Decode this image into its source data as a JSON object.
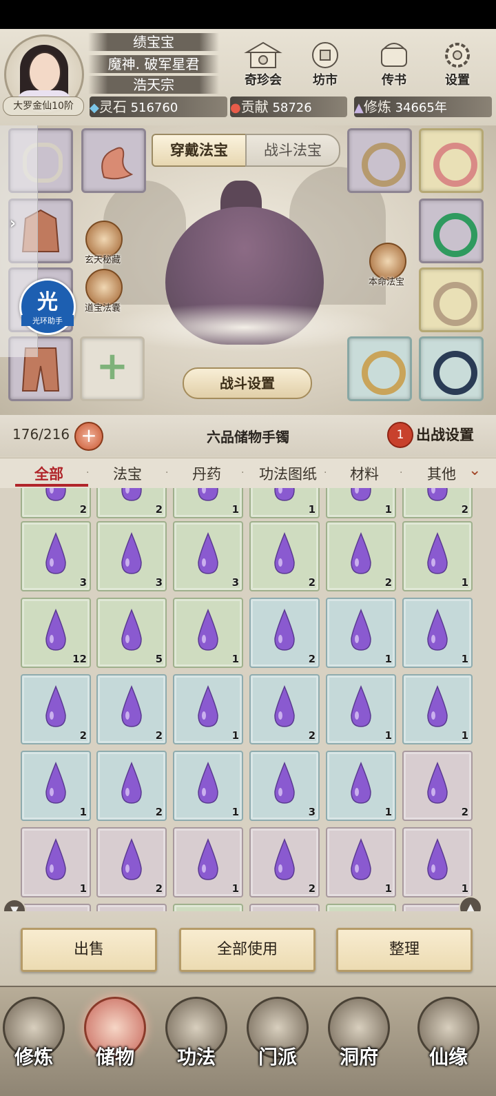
{
  "player": {
    "name": "绩宝宝",
    "title": "魔神. 破军星君",
    "sect": "浩天宗",
    "realm": "大罗金仙10阶"
  },
  "resources": {
    "spirit_stone_label": "灵石",
    "spirit_stone_value": "516760",
    "contribution_label": "贡献",
    "contribution_value": "58726",
    "cultivation_label": "修炼",
    "cultivation_value": "34665年"
  },
  "top_buttons": [
    {
      "label": "奇珍会",
      "icon": "pavilion-icon"
    },
    {
      "label": "坊市",
      "icon": "market-icon"
    },
    {
      "label": "传书",
      "icon": "scroll-icon"
    },
    {
      "label": "设置",
      "icon": "gear-icon"
    }
  ],
  "equip_tabs": {
    "wear": "穿戴法宝",
    "battle": "战斗法宝"
  },
  "side_icons": {
    "xuantian": "玄天秘藏",
    "daobao": "道宝法囊",
    "benming": "本命法宝"
  },
  "battle_settings_label": "战斗设置",
  "bag": {
    "capacity": "176/216",
    "title": "六品储物手镯",
    "deploy_count": "1",
    "deploy_label": "出战设置"
  },
  "filter_tabs": [
    "全部",
    "法宝",
    "丹药",
    "功法图纸",
    "材料",
    "其他"
  ],
  "grid": {
    "rows": [
      {
        "partial": true,
        "cells": [
          {
            "c": "g",
            "n": "2"
          },
          {
            "c": "g",
            "n": "2"
          },
          {
            "c": "g",
            "n": "1"
          },
          {
            "c": "g",
            "n": "1"
          },
          {
            "c": "g",
            "n": "1"
          },
          {
            "c": "g",
            "n": "2"
          }
        ]
      },
      {
        "cells": [
          {
            "c": "g",
            "n": "3"
          },
          {
            "c": "g",
            "n": "3"
          },
          {
            "c": "g",
            "n": "3"
          },
          {
            "c": "g",
            "n": "2"
          },
          {
            "c": "g",
            "n": "2"
          },
          {
            "c": "g",
            "n": "1"
          }
        ]
      },
      {
        "cells": [
          {
            "c": "g",
            "n": "12"
          },
          {
            "c": "g",
            "n": "5"
          },
          {
            "c": "g",
            "n": "1"
          },
          {
            "c": "b",
            "n": "2"
          },
          {
            "c": "b",
            "n": "1"
          },
          {
            "c": "b",
            "n": "1"
          }
        ]
      },
      {
        "cells": [
          {
            "c": "b",
            "n": "2"
          },
          {
            "c": "b",
            "n": "2"
          },
          {
            "c": "b",
            "n": "1"
          },
          {
            "c": "b",
            "n": "2"
          },
          {
            "c": "b",
            "n": "1"
          },
          {
            "c": "b",
            "n": "1"
          }
        ]
      },
      {
        "cells": [
          {
            "c": "b",
            "n": "1"
          },
          {
            "c": "b",
            "n": "2"
          },
          {
            "c": "b",
            "n": "1"
          },
          {
            "c": "b",
            "n": "3"
          },
          {
            "c": "b",
            "n": "1"
          },
          {
            "c": "p",
            "n": "2"
          }
        ]
      },
      {
        "cells": [
          {
            "c": "p",
            "n": "1"
          },
          {
            "c": "p",
            "n": "2"
          },
          {
            "c": "p",
            "n": "1"
          },
          {
            "c": "p",
            "n": "2"
          },
          {
            "c": "p",
            "n": "1"
          },
          {
            "c": "p",
            "n": "1"
          }
        ]
      },
      {
        "partial": true,
        "cells": [
          {
            "c": "p",
            "n": ""
          },
          {
            "c": "p",
            "n": ""
          },
          {
            "c": "g",
            "n": ""
          },
          {
            "c": "p",
            "n": ""
          },
          {
            "c": "g",
            "n": ""
          },
          {
            "c": "p",
            "n": ""
          }
        ]
      }
    ]
  },
  "actions": {
    "sell": "出售",
    "use_all": "全部使用",
    "sort": "整理"
  },
  "nav": [
    {
      "label": "修炼",
      "icon": "meditation-icon"
    },
    {
      "label": "储物",
      "icon": "pouch-icon"
    },
    {
      "label": "功法",
      "icon": "book-icon"
    },
    {
      "label": "门派",
      "icon": "gate-icon"
    },
    {
      "label": "洞府",
      "icon": "cave-icon"
    },
    {
      "label": "仙缘",
      "icon": "fate-icon"
    }
  ],
  "nav_active_index": 1,
  "helper": {
    "glyph": "光",
    "label": "光环助手"
  },
  "colors": {
    "active_tab": "#b0252a",
    "drop_purple": "#8a5ad0"
  }
}
